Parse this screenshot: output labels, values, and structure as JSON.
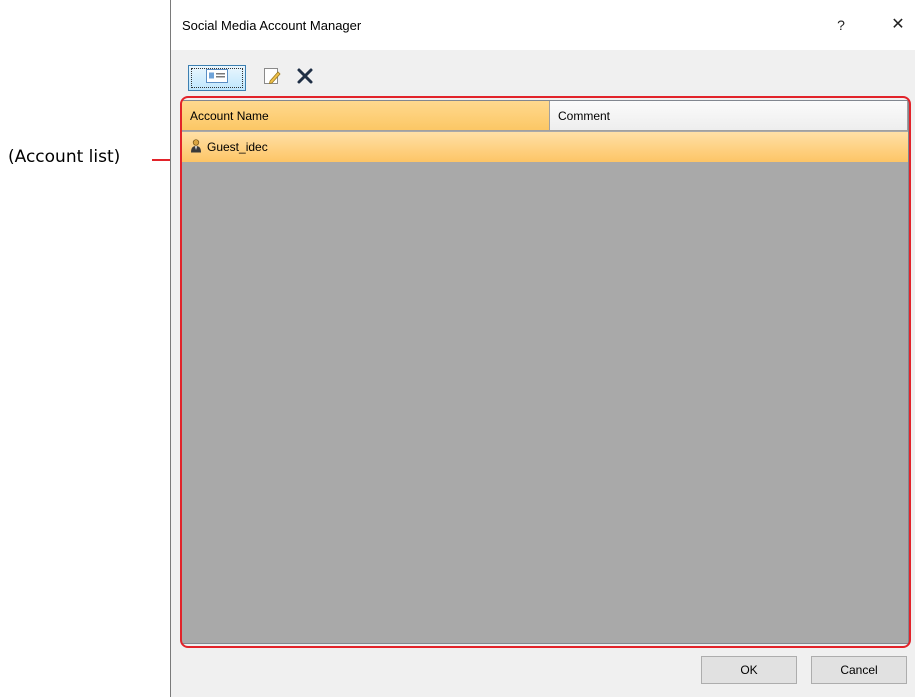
{
  "callout": {
    "label": "(Account list)"
  },
  "dialog": {
    "title": "Social Media Account Manager",
    "help_label": "?",
    "close_label": "✕"
  },
  "toolbar": {
    "new_icon": "new-account-icon",
    "edit_icon": "edit-account-icon",
    "delete_icon": "delete-account-icon"
  },
  "account_list": {
    "columns": [
      "Account Name",
      "Comment"
    ],
    "rows": [
      {
        "account_name": "Guest_idec",
        "comment": "",
        "icon": "user-icon"
      }
    ]
  },
  "buttons": {
    "ok_label": "OK",
    "cancel_label": "Cancel"
  },
  "colors": {
    "callout_red": "#e2232a",
    "selection_orange": "#fdc566",
    "list_background": "#a9a9a9"
  }
}
